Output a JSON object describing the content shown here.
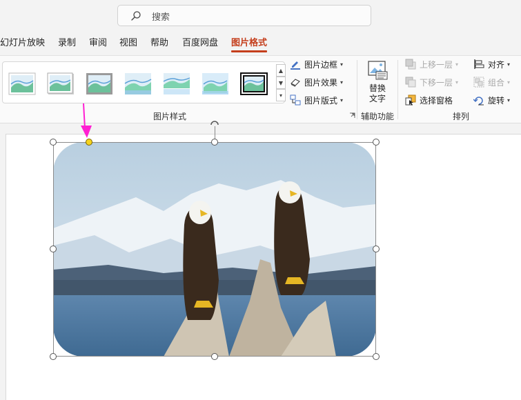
{
  "search": {
    "placeholder": "搜索"
  },
  "tabs": [
    {
      "label": "幻灯片放映"
    },
    {
      "label": "录制"
    },
    {
      "label": "审阅"
    },
    {
      "label": "视图"
    },
    {
      "label": "帮助"
    },
    {
      "label": "百度网盘"
    },
    {
      "label": "图片格式",
      "active": true
    }
  ],
  "ribbon": {
    "picture_styles": {
      "group_label": "图片样式",
      "style_count": 7,
      "commands": {
        "border": "图片边框",
        "effects": "图片效果",
        "layout": "图片版式"
      }
    },
    "accessibility": {
      "group_label": "辅助功能",
      "alt_text_line1": "替换",
      "alt_text_line2": "文字"
    },
    "arrange": {
      "group_label": "排列",
      "bring_forward": "上移一层",
      "send_backward": "下移一层",
      "selection_pane": "选择窗格",
      "align": "对齐",
      "group": "组合",
      "rotate": "旋转"
    }
  },
  "colors": {
    "active_tab": "#c43e1c",
    "annotation_arrow": "#ff1fd2",
    "adjust_handle": "#f5d31d"
  },
  "canvas": {
    "image_description_icon": "bald-eagles-photo",
    "selected": true
  }
}
